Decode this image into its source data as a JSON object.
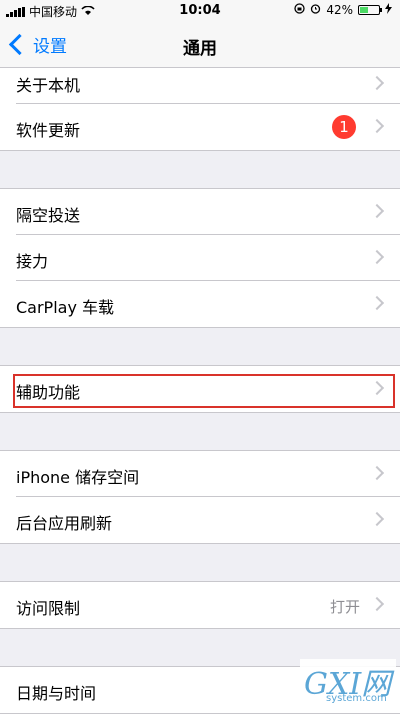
{
  "status": {
    "carrier": "中国移动",
    "time": "10:04",
    "battery_pct": "42%",
    "battery_level": 0.42
  },
  "nav": {
    "back_label": "设置",
    "title": "通用"
  },
  "groups": [
    [
      {
        "label": "关于本机"
      },
      {
        "label": "软件更新",
        "badge": "1"
      }
    ],
    [
      {
        "label": "隔空投送"
      },
      {
        "label": "接力"
      },
      {
        "label": "CarPlay 车载"
      }
    ],
    [
      {
        "label": "辅助功能"
      }
    ],
    [
      {
        "label": "iPhone 储存空间"
      },
      {
        "label": "后台应用刷新"
      }
    ],
    [
      {
        "label": "访问限制",
        "value": "打开"
      }
    ],
    [
      {
        "label": "日期与时间"
      }
    ]
  ],
  "watermark": {
    "big": "GXI网",
    "small": "system.com"
  },
  "colors": {
    "accent": "#007aff",
    "badge": "#ff3b30",
    "highlight": "#d9322a"
  }
}
